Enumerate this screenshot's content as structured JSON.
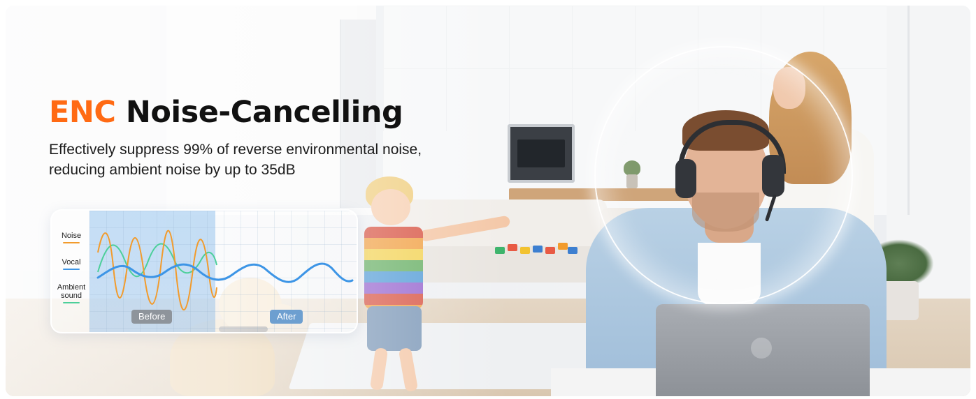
{
  "banner": {
    "title_accent": "ENC",
    "title_rest": "Noise-Cancelling",
    "subtitle_line1": "Effectively suppress 99% of reverse environmental noise,",
    "subtitle_line2": "reducing ambient noise by up to 35dB"
  },
  "diagram": {
    "legend": [
      {
        "label": "Noise",
        "color": "#f29b2c"
      },
      {
        "label": "Vocal",
        "color": "#3d95e6"
      },
      {
        "label_line1": "Ambient",
        "label_line2": "sound",
        "color": "#4ccf9a"
      }
    ],
    "before_label": "Before",
    "after_label": "After"
  },
  "colors": {
    "accent": "#ff6a13",
    "noise_wave": "#f29b2c",
    "vocal_wave": "#3d95e6",
    "ambient_wave": "#4ccf9a"
  }
}
